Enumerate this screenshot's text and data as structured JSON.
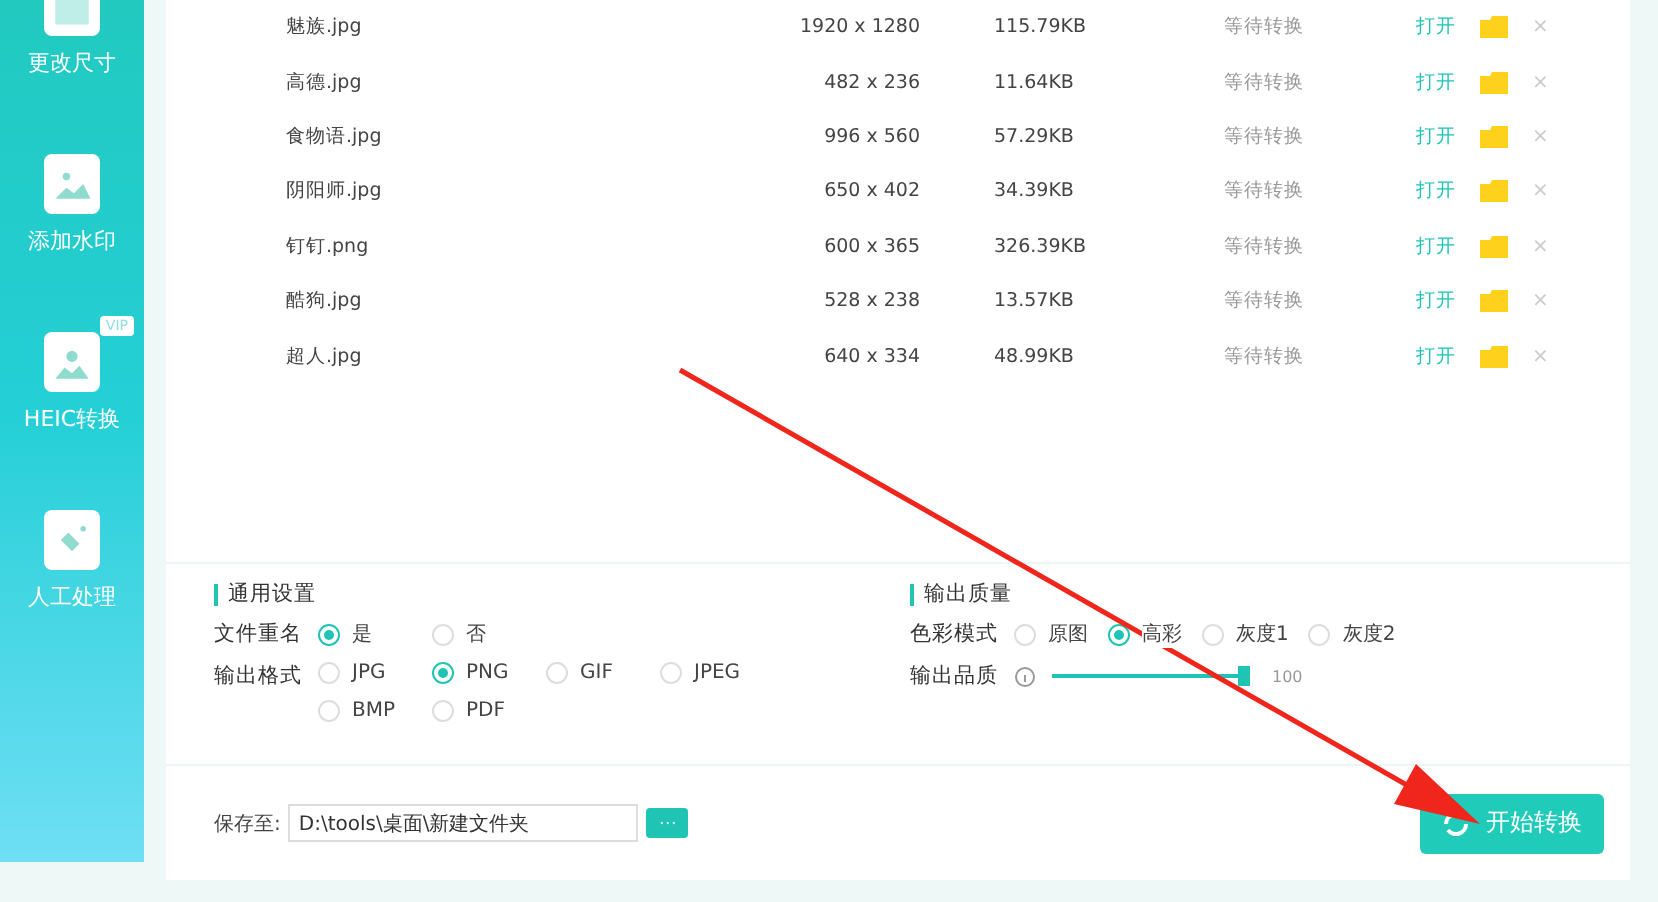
{
  "sidebar": {
    "items": [
      {
        "label": "更改尺寸"
      },
      {
        "label": "添加水印"
      },
      {
        "label": "HEIC转换",
        "badge": "VIP"
      },
      {
        "label": "人工处理"
      }
    ]
  },
  "files": [
    {
      "name": "魅族.jpg",
      "dimensions": "1920 x 1280",
      "size": "115.79KB",
      "status": "等待转换",
      "open": "打开",
      "delete": "×"
    },
    {
      "name": "高德.jpg",
      "dimensions": "482 x 236",
      "size": "11.64KB",
      "status": "等待转换",
      "open": "打开",
      "delete": "×"
    },
    {
      "name": "食物语.jpg",
      "dimensions": "996 x 560",
      "size": "57.29KB",
      "status": "等待转换",
      "open": "打开",
      "delete": "×"
    },
    {
      "name": "阴阳师.jpg",
      "dimensions": "650 x 402",
      "size": "34.39KB",
      "status": "等待转换",
      "open": "打开",
      "delete": "×"
    },
    {
      "name": "钉钉.png",
      "dimensions": "600 x 365",
      "size": "326.39KB",
      "status": "等待转换",
      "open": "打开",
      "delete": "×"
    },
    {
      "name": "酷狗.jpg",
      "dimensions": "528 x 238",
      "size": "13.57KB",
      "status": "等待转换",
      "open": "打开",
      "delete": "×"
    },
    {
      "name": "超人.jpg",
      "dimensions": "640 x 334",
      "size": "48.99KB",
      "status": "等待转换",
      "open": "打开",
      "delete": "×"
    }
  ],
  "general_settings": {
    "title": "通用设置",
    "rename": {
      "label": "文件重名",
      "options": [
        {
          "label": "是",
          "selected": true
        },
        {
          "label": "否",
          "selected": false
        }
      ]
    },
    "format": {
      "label": "输出格式",
      "options": [
        {
          "label": "JPG",
          "selected": false
        },
        {
          "label": "PNG",
          "selected": true
        },
        {
          "label": "GIF",
          "selected": false
        },
        {
          "label": "JPEG",
          "selected": false
        },
        {
          "label": "BMP",
          "selected": false
        },
        {
          "label": "PDF",
          "selected": false
        }
      ]
    }
  },
  "output_quality": {
    "title": "输出质量",
    "color_mode": {
      "label": "色彩模式",
      "options": [
        {
          "label": "原图",
          "selected": false
        },
        {
          "label": "高彩",
          "selected": true
        },
        {
          "label": "灰度1",
          "selected": false
        },
        {
          "label": "灰度2",
          "selected": false
        }
      ]
    },
    "quality": {
      "label": "输出品质",
      "level": 1.0,
      "reading": "100"
    }
  },
  "save": {
    "label": "保存至:",
    "value": "D:\\tools\\桌面\\新建文件夹",
    "browse": "···"
  },
  "start_button": "开始转换"
}
